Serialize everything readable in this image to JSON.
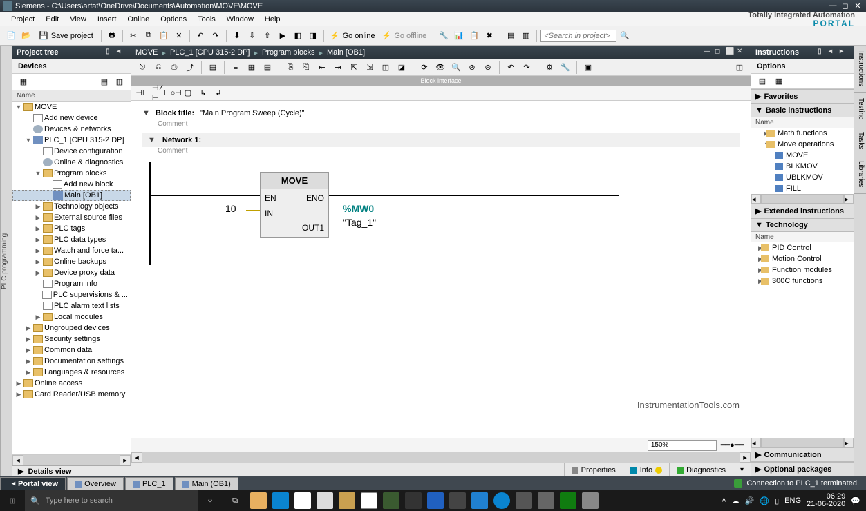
{
  "title": "Siemens  -  C:\\Users\\arfat\\OneDrive\\Documents\\Automation\\MOVE\\MOVE",
  "menus": [
    "Project",
    "Edit",
    "View",
    "Insert",
    "Online",
    "Options",
    "Tools",
    "Window",
    "Help"
  ],
  "brand": {
    "line1": "Totally Integrated Automation",
    "line2": "PORTAL"
  },
  "toolbar": {
    "save": "Save project",
    "go_online": "Go online",
    "go_offline": "Go offline",
    "search_ph": "<Search in project>"
  },
  "side_tab": "PLC programming",
  "project_tree": {
    "title": "Project tree",
    "devices": "Devices",
    "name": "Name",
    "root": "MOVE",
    "add_device": "Add new device",
    "dev_net": "Devices & networks",
    "plc": "PLC_1 [CPU 315-2 DP]",
    "dev_cfg": "Device configuration",
    "onl_diag": "Online & diagnostics",
    "prog_blocks": "Program blocks",
    "add_block": "Add new block",
    "main": "Main [OB1]",
    "tech_obj": "Technology objects",
    "ext_src": "External source files",
    "plc_tags": "PLC tags",
    "plc_dt": "PLC data types",
    "watch": "Watch and force ta...",
    "onl_bk": "Online backups",
    "dev_proxy": "Device proxy data",
    "prog_info": "Program info",
    "plc_sup": "PLC supervisions & ...",
    "alarm": "PLC alarm text lists",
    "local_mod": "Local modules",
    "ungrp": "Ungrouped devices",
    "sec": "Security settings",
    "common": "Common data",
    "doc_set": "Documentation settings",
    "lang": "Languages & resources",
    "onl_acc": "Online access",
    "card": "Card Reader/USB memory"
  },
  "breadcrumb": [
    "MOVE",
    "PLC_1 [CPU 315-2 DP]",
    "Program blocks",
    "Main [OB1]"
  ],
  "block_iface": "Block interface",
  "block_title_label": "Block title:",
  "block_title_value": "\"Main Program Sweep (Cycle)\"",
  "comment": "Comment",
  "network": "Network 1:",
  "move_block": {
    "title": "MOVE",
    "en": "EN",
    "eno": "ENO",
    "in": "IN",
    "out": "OUT1",
    "in_val": "10",
    "out_addr": "%MW0",
    "out_tag": "\"Tag_1\""
  },
  "watermark": "InstrumentationTools.com",
  "zoom": "150%",
  "bottom_tabs": {
    "props": "Properties",
    "info": "Info",
    "diag": "Diagnostics"
  },
  "instr": {
    "title": "Instructions",
    "options": "Options",
    "favs": "Favorites",
    "basic": "Basic instructions",
    "name": "Name",
    "math": "Math functions",
    "moveops": "Move operations",
    "items": [
      "MOVE",
      "BLKMOV",
      "UBLKMOV",
      "FILL"
    ],
    "ext": "Extended instructions",
    "tech": "Technology",
    "tech_items": [
      "PID Control",
      "Motion Control",
      "Function modules",
      "300C functions"
    ],
    "comm": "Communication",
    "optpkg": "Optional packages"
  },
  "right_tabs": [
    "Instructions",
    "Testing",
    "Tasks",
    "Libraries"
  ],
  "details": "Details view",
  "viewtabs": {
    "portal": "Portal view",
    "overview": "Overview",
    "plc": "PLC_1",
    "main": "Main (OB1)"
  },
  "status": "Connection to PLC_1 terminated.",
  "win": {
    "search": "Type here to search",
    "lang": "ENG",
    "time": "06:29",
    "date": "21-06-2020"
  }
}
